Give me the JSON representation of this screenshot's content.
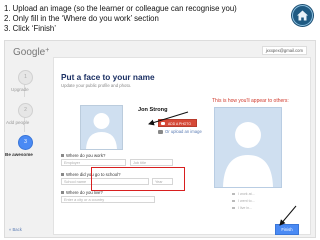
{
  "instructions": [
    "1. Upload an image (so the learner or colleague can recognise you)",
    "2. Only fill in the ‘Where do you work’ section",
    "3. Click ‘Finish’"
  ],
  "app": {
    "logo": "Google",
    "logo_plus": "+",
    "email": "jxxxpex@gmail.com"
  },
  "steps": [
    {
      "number": "1",
      "label": "Upgrade"
    },
    {
      "number": "2",
      "label": "Add people"
    },
    {
      "number": "3",
      "label": "Be awesome"
    }
  ],
  "card": {
    "title": "Put a face to your name",
    "subtitle": "Update your public profile and photo."
  },
  "profile": {
    "name": "Jon Strong",
    "upload_button": "ADD A PHOTO",
    "webcam_link": "Or upload an image",
    "preview_label": "This is how you'll appear to others:"
  },
  "sections": {
    "work": {
      "label": "Where do you work?",
      "employer_placeholder": "Employer",
      "job_placeholder": "Job title"
    },
    "school": {
      "label": "Where did you go to school?",
      "school_placeholder": "School name",
      "year_placeholder": "Year"
    },
    "live": {
      "label": "Where do you live?",
      "city_placeholder": "Enter a city or a country"
    }
  },
  "preview_info": [
    "I work at...",
    "I went to...",
    "I live in..."
  ],
  "footer": {
    "back": "« Back",
    "finish": "Finish"
  },
  "colors": {
    "accent_blue": "#4a8af4",
    "highlight_red": "#d81f1f",
    "title_navy": "#1a2f63",
    "button_red": "#d64937"
  }
}
